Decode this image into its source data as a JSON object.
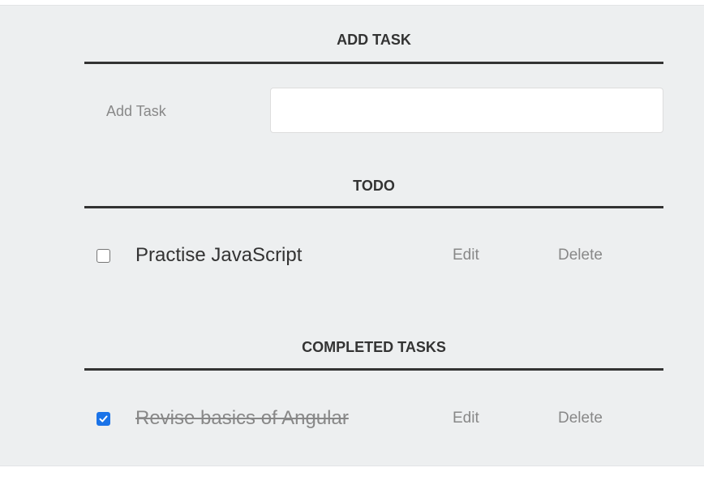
{
  "add_section": {
    "title": "ADD TASK",
    "input_label": "Add Task",
    "input_value": ""
  },
  "todo_section": {
    "title": "TODO",
    "tasks": [
      {
        "text": "Practise JavaScript",
        "checked": false,
        "edit_label": "Edit",
        "delete_label": "Delete"
      }
    ]
  },
  "completed_section": {
    "title": "COMPLETED TASKS",
    "tasks": [
      {
        "text": "Revise basics of Angular",
        "checked": true,
        "edit_label": "Edit",
        "delete_label": "Delete"
      }
    ]
  },
  "colors": {
    "background": "#edeff0",
    "checkbox_checked": "#1a73e8",
    "muted_text": "#888888",
    "heading_text": "#333333"
  }
}
